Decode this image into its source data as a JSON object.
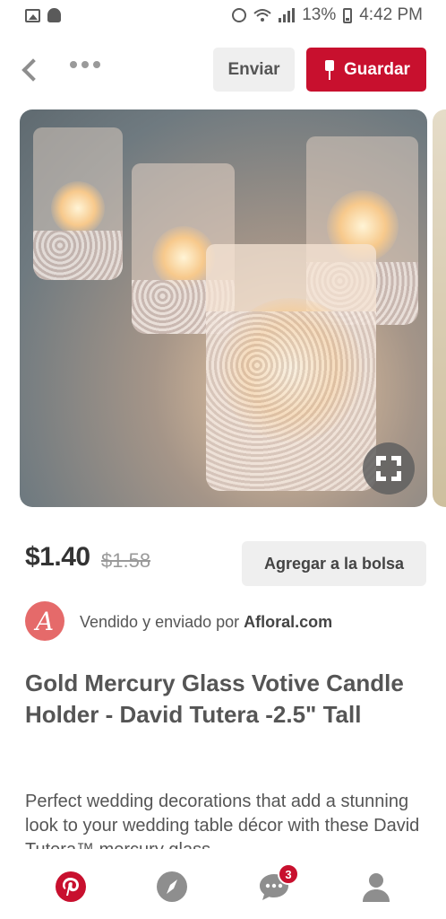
{
  "status_bar": {
    "battery": "13%",
    "time": "4:42 PM",
    "icons": [
      "gallery-icon",
      "snapchat-icon",
      "alarm-icon",
      "wifi-icon",
      "signal-icon",
      "battery-icon"
    ]
  },
  "header": {
    "back_icon": "chevron-left-icon",
    "more_icon": "more-horizontal-icon",
    "send_label": "Enviar",
    "save_label": "Guardar",
    "save_icon": "pin-icon"
  },
  "pin": {
    "image_alt": "Votive candle holders",
    "fullscreen_icon": "expand-icon",
    "price": "$1.40",
    "old_price": "$1.58",
    "add_to_bag_label": "Agregar a la bolsa",
    "seller": {
      "avatar_letter": "A",
      "prefix": "Vendido y enviado por",
      "name": "Afloral.com"
    },
    "title": "Gold Mercury Glass Votive Candle Holder - David Tutera -2.5\" Tall",
    "description": "Perfect wedding decorations that add a stunning look to your wedding table décor with these David Tutera™ mercury glass"
  },
  "bottom_nav": {
    "items": [
      "home-icon",
      "explore-icon",
      "messages-icon",
      "profile-icon"
    ],
    "messages_badge": "3"
  },
  "colors": {
    "brand_red": "#c8102e",
    "button_gray": "#efefef",
    "text": "#555555",
    "avatar": "#e56a6a"
  }
}
